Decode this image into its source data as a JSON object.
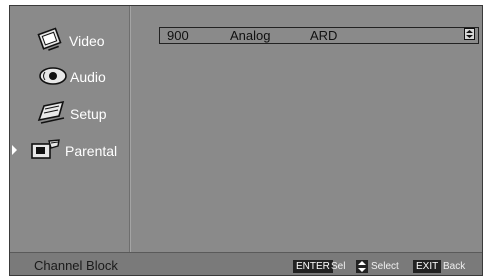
{
  "menu": {
    "items": [
      {
        "label": "Video",
        "icon": "video-icon"
      },
      {
        "label": "Audio",
        "icon": "audio-icon"
      },
      {
        "label": "Setup",
        "icon": "setup-icon"
      },
      {
        "label": "Parental",
        "icon": "parental-icon",
        "selected": true
      }
    ]
  },
  "channel": {
    "number": "900",
    "type": "Analog",
    "name": "ARD",
    "scroll_icon": "up-down-arrows-icon"
  },
  "status": {
    "title": "Channel Block",
    "hints": [
      {
        "key": "ENTER",
        "text": "Sel"
      },
      {
        "key": "⬍",
        "text": "Select"
      },
      {
        "key": "EXIT",
        "text": "Back"
      }
    ]
  },
  "colors": {
    "background": "#8a8a8a",
    "text": "#ffffff"
  }
}
